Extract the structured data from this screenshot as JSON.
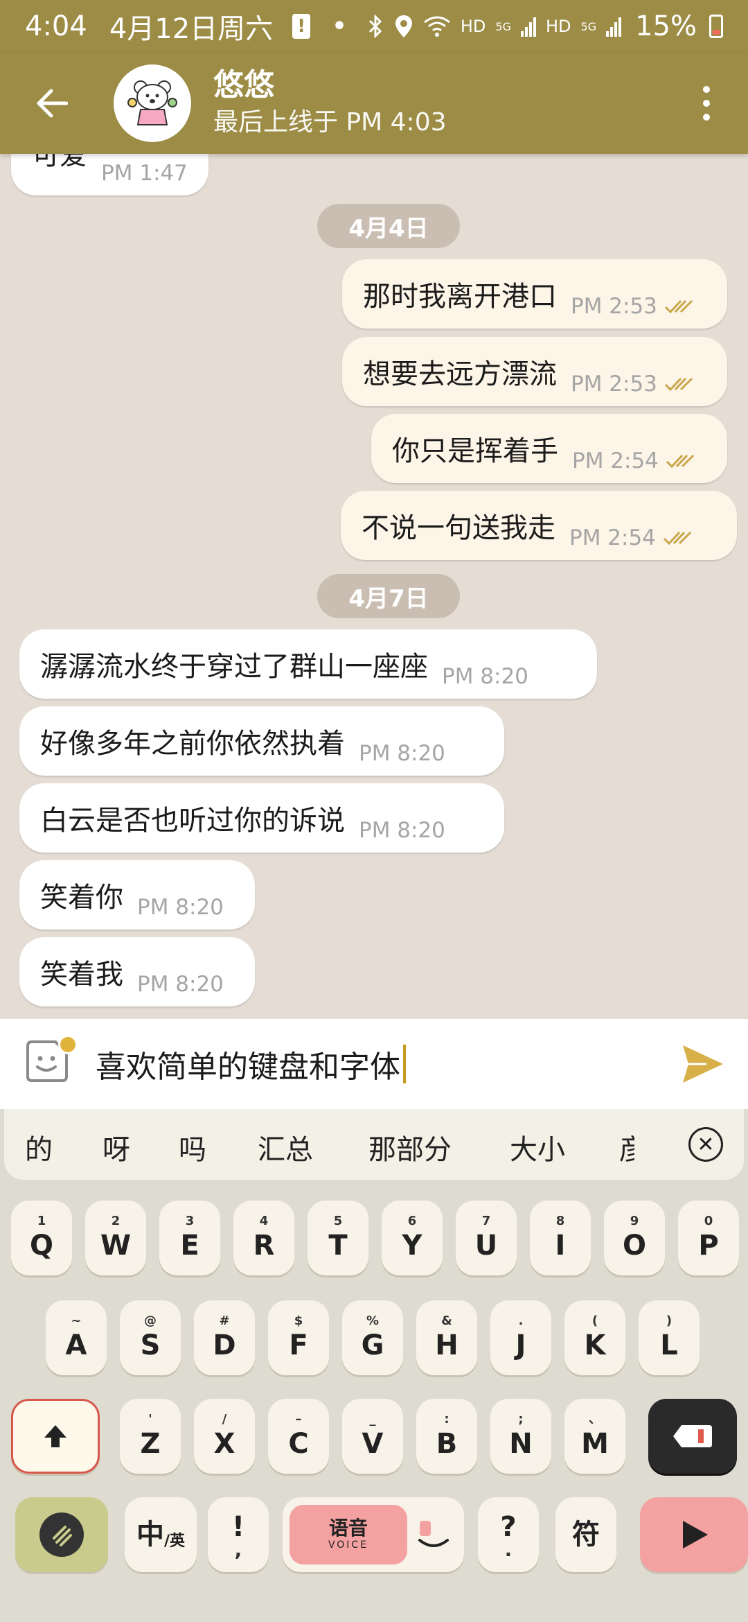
{
  "status_bar": {
    "time": "4:04",
    "date": "4月12日周六",
    "battery_percent": "15%",
    "network_labels": [
      "HD",
      "5G",
      "HD",
      "5G"
    ]
  },
  "header": {
    "contact_name": "悠悠",
    "last_seen": "最后上线于 PM 4:03"
  },
  "chat": {
    "partial_top": {
      "text": "可爱",
      "time": "PM 1:47"
    },
    "date_chips": [
      "4月4日",
      "4月7日"
    ],
    "outgoing": [
      {
        "text": "那时我离开港口",
        "time": "PM 2:53"
      },
      {
        "text": "想要去远方漂流",
        "time": "PM 2:53"
      },
      {
        "text": "你只是挥着手",
        "time": "PM 2:54"
      },
      {
        "text": "不说一句送我走",
        "time": "PM 2:54"
      }
    ],
    "incoming": [
      {
        "text": "潺潺流水终于穿过了群山一座座",
        "time": "PM 8:20"
      },
      {
        "text": "好像多年之前你依然执着",
        "time": "PM 8:20"
      },
      {
        "text": "白云是否也听过你的诉说",
        "time": "PM 8:20"
      },
      {
        "text": "笑着你",
        "time": "PM 8:20"
      },
      {
        "text": "笑着我",
        "time": "PM 8:20"
      }
    ]
  },
  "composer": {
    "text": "喜欢简单的键盘和字体"
  },
  "keyboard": {
    "suggestions": [
      "的",
      "呀",
      "吗",
      "汇总",
      "那部分",
      "大小",
      "彦"
    ],
    "row1": [
      {
        "hint": "1",
        "key": "Q"
      },
      {
        "hint": "2",
        "key": "W"
      },
      {
        "hint": "3",
        "key": "E"
      },
      {
        "hint": "4",
        "key": "R"
      },
      {
        "hint": "5",
        "key": "T"
      },
      {
        "hint": "6",
        "key": "Y"
      },
      {
        "hint": "7",
        "key": "U"
      },
      {
        "hint": "8",
        "key": "I"
      },
      {
        "hint": "9",
        "key": "O"
      },
      {
        "hint": "0",
        "key": "P"
      }
    ],
    "row2": [
      {
        "hint": "~",
        "key": "A"
      },
      {
        "hint": "@",
        "key": "S"
      },
      {
        "hint": "#",
        "key": "D"
      },
      {
        "hint": "$",
        "key": "F"
      },
      {
        "hint": "%",
        "key": "G"
      },
      {
        "hint": "&",
        "key": "H"
      },
      {
        "hint": ".",
        "key": "J"
      },
      {
        "hint": "(",
        "key": "K"
      },
      {
        "hint": ")",
        "key": "L"
      }
    ],
    "row3": [
      {
        "hint": "'",
        "key": "Z"
      },
      {
        "hint": "/",
        "key": "X"
      },
      {
        "hint": "–",
        "key": "C"
      },
      {
        "hint": "_",
        "key": "V"
      },
      {
        "hint": ":",
        "key": "B"
      },
      {
        "hint": ";",
        "key": "N"
      },
      {
        "hint": "、",
        "key": "M"
      }
    ],
    "lang_label_main": "中",
    "lang_label_sub": "/英",
    "punct_main": "!",
    "punct_hint": ",",
    "voice_label": "语音",
    "voice_sub": "VOICE",
    "question_main": "?",
    "question_hint": ".",
    "symbol_label": "符"
  }
}
